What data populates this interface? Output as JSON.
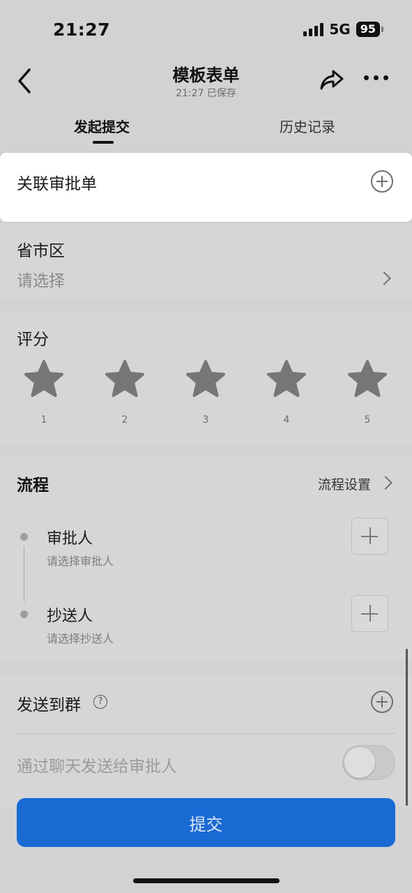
{
  "status_bar": {
    "time": "21:27",
    "network": "5G",
    "battery": "95"
  },
  "nav": {
    "title": "模板表单",
    "subtitle": "21:27 已保存"
  },
  "tabs": [
    {
      "label": "发起提交",
      "active": true
    },
    {
      "label": "历史记录",
      "active": false
    }
  ],
  "form": {
    "associate_label": "关联审批单",
    "region": {
      "label": "省市区",
      "placeholder": "请选择"
    },
    "rating": {
      "label": "评分",
      "scale": [
        "1",
        "2",
        "3",
        "4",
        "5"
      ],
      "value": 0
    },
    "flow": {
      "title": "流程",
      "settings_label": "流程设置",
      "nodes": [
        {
          "title": "审批人",
          "subtitle": "请选择审批人"
        },
        {
          "title": "抄送人",
          "subtitle": "请选择抄送人"
        }
      ]
    },
    "send_group": {
      "label": "发送到群",
      "help": "?"
    },
    "chat_send": {
      "label": "通过聊天发送给审批人",
      "enabled": false
    }
  },
  "submit_label": "提交",
  "colors": {
    "accent": "#1a6ad4",
    "overlay_bg": "#d2d2d5",
    "star": "#767676"
  },
  "icons": [
    "back-icon",
    "share-icon",
    "more-icon",
    "plus-circle-icon",
    "chevron-right-icon",
    "star-icon",
    "plus-icon",
    "help-icon"
  ]
}
